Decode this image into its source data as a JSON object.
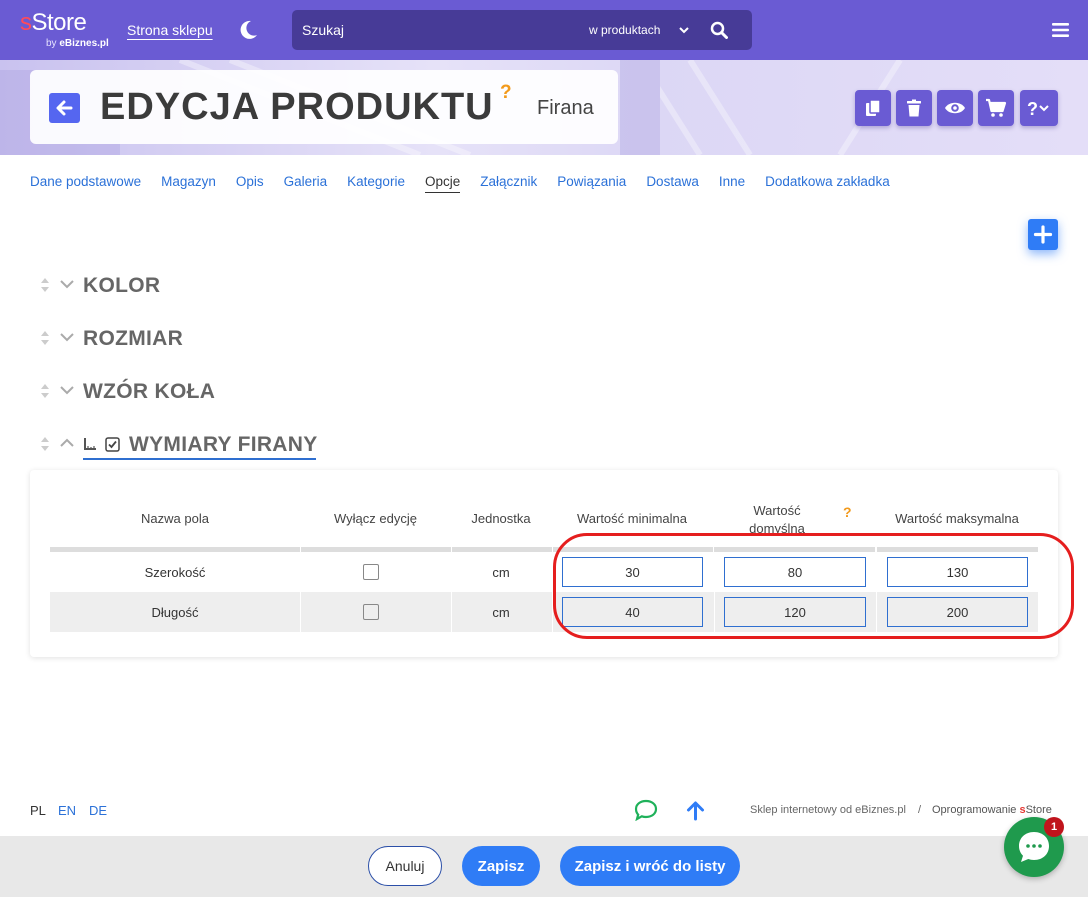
{
  "topbar": {
    "logo_main": "Store",
    "logo_s": "s",
    "logo_by": "by",
    "logo_brand": "eBiznes.pl",
    "shop_link": "Strona sklepu",
    "search_placeholder": "Szukaj",
    "search_scope": "w produktach"
  },
  "header": {
    "title": "EDYCJA PRODUKTU",
    "help": "?",
    "product_name": "Firana",
    "actions": [
      "copy-icon",
      "trash-icon",
      "eye-icon",
      "cart-icon",
      "help-dropdown-icon"
    ]
  },
  "tabs": [
    {
      "label": "Dane podstawowe",
      "active": false
    },
    {
      "label": "Magazyn",
      "active": false
    },
    {
      "label": "Opis",
      "active": false
    },
    {
      "label": "Galeria",
      "active": false
    },
    {
      "label": "Kategorie",
      "active": false
    },
    {
      "label": "Opcje",
      "active": true
    },
    {
      "label": "Załącznik",
      "active": false
    },
    {
      "label": "Powiązania",
      "active": false
    },
    {
      "label": "Dostawa",
      "active": false
    },
    {
      "label": "Inne",
      "active": false
    },
    {
      "label": "Dodatkowa zakładka",
      "active": false
    }
  ],
  "option_groups": [
    {
      "title": "KOLOR",
      "expanded": false
    },
    {
      "title": "ROZMIAR",
      "expanded": false
    },
    {
      "title": "WZÓR KOŁA",
      "expanded": false
    },
    {
      "title": "WYMIARY FIRANY",
      "expanded": true
    }
  ],
  "table": {
    "headers": {
      "name": "Nazwa pola",
      "disable_edit": "Wyłącz edycję",
      "unit": "Jednostka",
      "min": "Wartość minimalna",
      "default_line1": "Wartość",
      "default_line2": "domyślna",
      "default_help": "?",
      "max": "Wartość maksymalna"
    },
    "rows": [
      {
        "name": "Szerokość",
        "disabled": false,
        "unit": "cm",
        "min": "30",
        "default": "80",
        "max": "130"
      },
      {
        "name": "Długość",
        "disabled": false,
        "unit": "cm",
        "min": "40",
        "default": "120",
        "max": "200"
      }
    ]
  },
  "footer": {
    "languages": [
      {
        "code": "PL",
        "active": true
      },
      {
        "code": "EN",
        "active": false
      },
      {
        "code": "DE",
        "active": false
      }
    ],
    "credit_left": "Sklep internetowy od eBiznes.pl",
    "credit_sep": "/",
    "credit_right_prefix": "Oprogramowanie ",
    "credit_right_s": "s",
    "credit_right_store": "Store"
  },
  "bottom_bar": {
    "cancel": "Anuluj",
    "save": "Zapisz",
    "save_back": "Zapisz i wróć do listy"
  },
  "chat": {
    "badge": "1"
  },
  "colors": {
    "topbar": "#6a5bd3",
    "accent_blue": "#2f7cf6",
    "highlight_red": "#e51e1e",
    "chat_green": "#1f9a4d",
    "help_orange": "#f29a1c"
  }
}
